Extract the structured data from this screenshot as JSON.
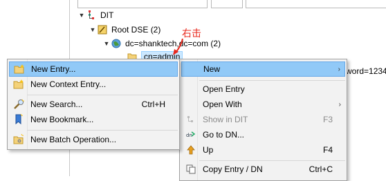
{
  "tree": {
    "root_label": "DIT",
    "root_dse_label": "Root DSE (2)",
    "base_dn_label": "dc=shanktech,dc=com (2)",
    "child_label": "cn=admin"
  },
  "annotation": {
    "text": "右击",
    "color": "#e8281d"
  },
  "background_text": "word=1234",
  "left_menu": {
    "items": [
      {
        "label": "New Entry...",
        "shortcut": "",
        "icon": "new-entry-icon",
        "highlighted": true
      },
      {
        "label": "New Context Entry...",
        "shortcut": "",
        "icon": "new-context-entry-icon"
      },
      {
        "label": "New Search...",
        "shortcut": "Ctrl+H",
        "icon": "new-search-icon"
      },
      {
        "label": "New Bookmark...",
        "shortcut": "",
        "icon": "new-bookmark-icon"
      },
      {
        "label": "New Batch Operation...",
        "shortcut": "",
        "icon": "new-batch-operation-icon"
      }
    ]
  },
  "right_menu": {
    "items": [
      {
        "label": "New",
        "shortcut": "",
        "submenu": true,
        "highlighted": true
      },
      {
        "label": "Open Entry",
        "shortcut": ""
      },
      {
        "label": "Open With",
        "shortcut": "",
        "submenu": true
      },
      {
        "label": "Show in DIT",
        "shortcut": "F3",
        "disabled": true,
        "icon": "show-in-dit-icon"
      },
      {
        "label": "Go to DN...",
        "shortcut": "",
        "icon": "go-to-dn-icon"
      },
      {
        "label": "Up",
        "shortcut": "F4",
        "icon": "up-arrow-icon"
      },
      {
        "label": "Copy Entry / DN",
        "shortcut": "Ctrl+C",
        "icon": "copy-icon"
      }
    ]
  },
  "colors": {
    "highlight": "#91c9f7",
    "menu_bg": "#f2f2f2",
    "selected_node_bg": "#cce8ff"
  }
}
